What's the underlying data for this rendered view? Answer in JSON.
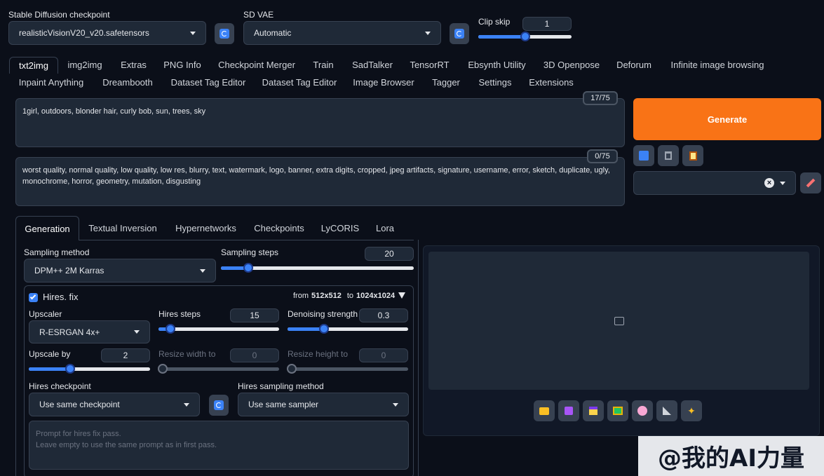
{
  "top": {
    "checkpoint_label": "Stable Diffusion checkpoint",
    "checkpoint_value": "realisticVisionV20_v20.safetensors",
    "vae_label": "SD VAE",
    "vae_value": "Automatic",
    "clip_label": "Clip skip",
    "clip_value": "1",
    "clip_level": 0.5
  },
  "tabs_row1": [
    "txt2img",
    "img2img",
    "Extras",
    "PNG Info",
    "Checkpoint Merger",
    "Train",
    "SadTalker",
    "TensorRT",
    "Ebsynth Utility",
    "3D Openpose",
    "Deforum",
    "Infinite image browsing"
  ],
  "tabs_row2": [
    "Inpaint Anything",
    "Dreambooth",
    "Dataset Tag Editor",
    "Dataset Tag Editor",
    "Image Browser",
    "Tagger",
    "Settings",
    "Extensions"
  ],
  "prompt": {
    "text": "1girl, outdoors, blonder hair, curly bob, sun, trees, sky",
    "counter": "17/75"
  },
  "negative": {
    "text": "worst quality, normal quality, low quality, low res, blurry, text, watermark, logo, banner, extra digits, cropped, jpeg artifacts, signature, username, error, sketch, duplicate, ugly, monochrome, horror, geometry, mutation, disgusting",
    "counter": "0/75"
  },
  "generate_label": "Generate",
  "subtabs": [
    "Generation",
    "Textual Inversion",
    "Hypernetworks",
    "Checkpoints",
    "LyCORIS",
    "Lora"
  ],
  "sampling": {
    "method_label": "Sampling method",
    "method_value": "DPM++ 2M Karras",
    "steps_label": "Sampling steps",
    "steps_value": "20",
    "steps_level": 0.14
  },
  "hires": {
    "label": "Hires. fix",
    "from_prefix": "from",
    "from_size": "512x512",
    "to_prefix": "to",
    "to_size": "1024x1024",
    "upscaler_label": "Upscaler",
    "upscaler_value": "R-ESRGAN 4x+",
    "steps_label": "Hires steps",
    "steps_value": "15",
    "steps_level": 0.1,
    "denoise_label": "Denoising strength",
    "denoise_value": "0.3",
    "denoise_level": 0.3,
    "upscale_label": "Upscale by",
    "upscale_value": "2",
    "upscale_level": 0.34,
    "rw_label": "Resize width to",
    "rw_value": "0",
    "rh_label": "Resize height to",
    "rh_value": "0",
    "ckpt_label": "Hires checkpoint",
    "ckpt_value": "Use same checkpoint",
    "sampler_label": "Hires sampling method",
    "sampler_value": "Use same sampler",
    "prompt_placeholder": "Prompt for hires fix pass.\nLeave empty to use the same prompt as in first pass."
  },
  "watermark": "@我的AI力量",
  "colors": {
    "accent": "#f97316",
    "primary": "#3b82f6",
    "bg": "#0b0f19"
  }
}
